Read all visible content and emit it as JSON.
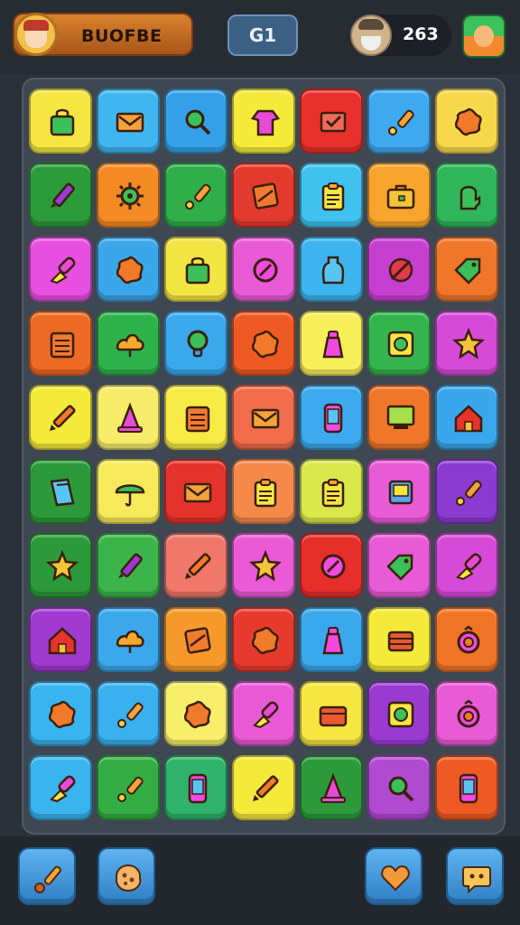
{
  "header": {
    "player_name": "BUOFBE",
    "level_label": "G1",
    "opponent_score": "263"
  },
  "board": {
    "columns": 7,
    "rows": 10,
    "tiles": [
      [
        "#f5e642",
        "bag"
      ],
      [
        "#3fb6f0",
        "envelope"
      ],
      [
        "#34a0e8",
        "magnifier"
      ],
      [
        "#f4ea3a",
        "shirt"
      ],
      [
        "#e8302c",
        "checkbox"
      ],
      [
        "#3fa9f0",
        "brush"
      ],
      [
        "#f7d84a",
        "blob"
      ],
      [
        "#2c9c3a",
        "pen"
      ],
      [
        "#f48a24",
        "gear"
      ],
      [
        "#2fae4a",
        "brush"
      ],
      [
        "#e33a2e",
        "note"
      ],
      [
        "#3fc3ee",
        "clipboard"
      ],
      [
        "#f7a52c",
        "briefcase"
      ],
      [
        "#2fb65a",
        "mitten"
      ],
      [
        "#e74fe0",
        "paintbrush"
      ],
      [
        "#3ba6ea",
        "blob"
      ],
      [
        "#f4e642",
        "bag"
      ],
      [
        "#e85ad6",
        "circle"
      ],
      [
        "#3db4ee",
        "vase"
      ],
      [
        "#c63fd0",
        "pacman"
      ],
      [
        "#f0762a",
        "tag"
      ],
      [
        "#ef6a24",
        "notepad"
      ],
      [
        "#2fb24c",
        "cloud"
      ],
      [
        "#39a9ec",
        "bulb"
      ],
      [
        "#ef5a24",
        "blob"
      ],
      [
        "#f7ef5a",
        "bottle"
      ],
      [
        "#34b44e",
        "frame"
      ],
      [
        "#d64ad8",
        "star"
      ],
      [
        "#f4ea3a",
        "pencil"
      ],
      [
        "#f7ec6a",
        "cone"
      ],
      [
        "#f6ea44",
        "notepad"
      ],
      [
        "#f06c4a",
        "envelope"
      ],
      [
        "#3da9ee",
        "phone"
      ],
      [
        "#f0762a",
        "monitor"
      ],
      [
        "#3aa7ec",
        "house"
      ],
      [
        "#2c9a3a",
        "book"
      ],
      [
        "#f7ea5a",
        "umbrella"
      ],
      [
        "#e4332c",
        "envelope"
      ],
      [
        "#f5894a",
        "clipboard"
      ],
      [
        "#d9e84a",
        "clipboard"
      ],
      [
        "#e85ad6",
        "tablet"
      ],
      [
        "#8a3ad0",
        "brush"
      ],
      [
        "#2c9a3a",
        "star"
      ],
      [
        "#3cb44a",
        "pen"
      ],
      [
        "#f0786a",
        "pencil"
      ],
      [
        "#ea5ad6",
        "star"
      ],
      [
        "#e62e2a",
        "circle"
      ],
      [
        "#e85ad6",
        "tag"
      ],
      [
        "#d64ad8",
        "paintbrush"
      ],
      [
        "#a03ad0",
        "house"
      ],
      [
        "#3ba8ec",
        "cloud"
      ],
      [
        "#f59a2a",
        "note"
      ],
      [
        "#e63a2e",
        "blob"
      ],
      [
        "#3aa8ec",
        "bottle"
      ],
      [
        "#f4ea3a",
        "barrel"
      ],
      [
        "#f07428",
        "ring"
      ],
      [
        "#3ab4ee",
        "blob"
      ],
      [
        "#3ab0ee",
        "brush"
      ],
      [
        "#f7ee6a",
        "blob"
      ],
      [
        "#e85ad6",
        "paintbrush"
      ],
      [
        "#f6e642",
        "box"
      ],
      [
        "#9a3ad0",
        "frame"
      ],
      [
        "#e85ad6",
        "ring"
      ],
      [
        "#3ab4ee",
        "paintbrush"
      ],
      [
        "#34ae44",
        "brush"
      ],
      [
        "#2fb26a",
        "phone"
      ],
      [
        "#f4ea3a",
        "pencil"
      ],
      [
        "#2c9a3a",
        "cone"
      ],
      [
        "#b04ad0",
        "magnifier"
      ],
      [
        "#ef5a24",
        "phone"
      ]
    ]
  },
  "toolbar": {
    "buttons": [
      "brush-icon",
      "cookie-icon",
      "heart-icon",
      "chat-icon"
    ]
  }
}
